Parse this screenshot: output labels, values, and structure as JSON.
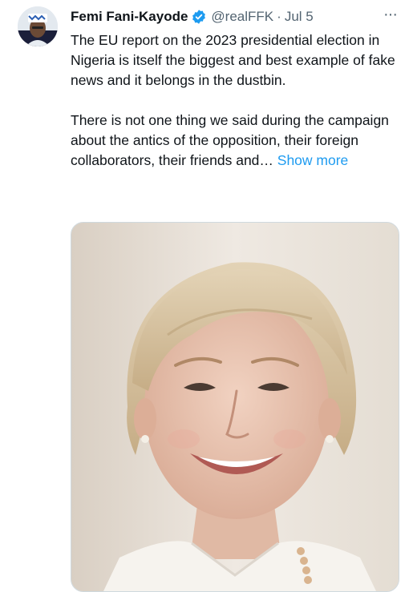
{
  "tweet": {
    "author": {
      "name": "Femi Fani-Kayode",
      "handle": "@realFFK",
      "verified": true
    },
    "separator": "·",
    "date": "Jul 5",
    "paragraphs": [
      "The EU report on the 2023 presidential election in Nigeria is itself the biggest and best example of fake news and it belongs in the dustbin.",
      "There is not one thing we said during the campaign about the antics of the opposition, their foreign collaborators, their friends and…"
    ],
    "show_more_label": "Show more",
    "more_icon": "···"
  },
  "colors": {
    "accent": "#1d9bf0",
    "secondary_text": "#536471",
    "primary_text": "#0f1419"
  },
  "icons": {
    "verified": "verified-badge-icon",
    "more": "more-horizontal-icon"
  }
}
